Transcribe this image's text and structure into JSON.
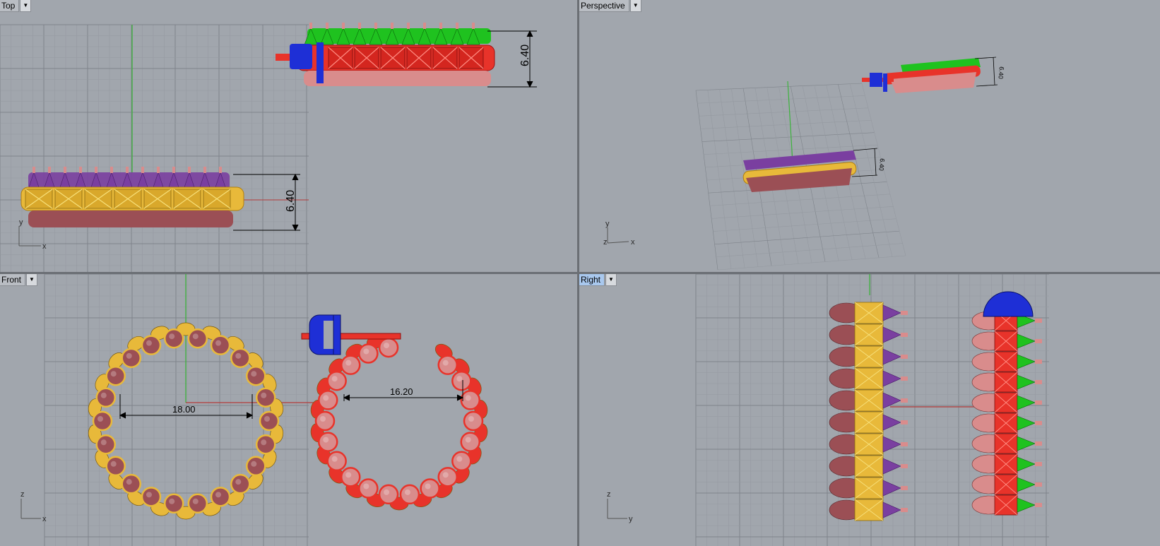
{
  "viewports": {
    "top": {
      "title": "Top",
      "menu_icon": "dropdown-arrow-icon",
      "dimension_earring_a": "6.40",
      "dimension_earring_b": "6.40",
      "axis_x": "x",
      "axis_y": "y"
    },
    "perspective": {
      "title": "Perspective",
      "menu_icon": "dropdown-arrow-icon",
      "dimension_earring_a": "6.40",
      "dimension_earring_b": "6.40",
      "axis_x": "x",
      "axis_y": "y",
      "axis_z": "z"
    },
    "front": {
      "title": "Front",
      "menu_icon": "dropdown-arrow-icon",
      "dimension_earring_a": "18.00",
      "dimension_earring_b": "16.20",
      "axis_x": "x",
      "axis_z": "z"
    },
    "right": {
      "title": "Right",
      "menu_icon": "dropdown-arrow-icon",
      "axis_y": "y",
      "axis_z": "z",
      "active": true
    }
  },
  "colors": {
    "viewport_bg": "#a1a6ad",
    "grid_minor": "#959aa1",
    "grid_major": "#7f848b",
    "earring_a_band": "#e8b93a",
    "earring_a_spike": "#7a3fa0",
    "earring_a_drop": "#9b4f55",
    "earring_b_band": "#e8332a",
    "earring_b_spike": "#1fc21f",
    "earring_b_drop": "#d98c8c",
    "clasp": "#1e2fd6",
    "post": "#e8332a",
    "y_axis_line": "#3db33d",
    "x_axis_line": "#b33a3a"
  }
}
